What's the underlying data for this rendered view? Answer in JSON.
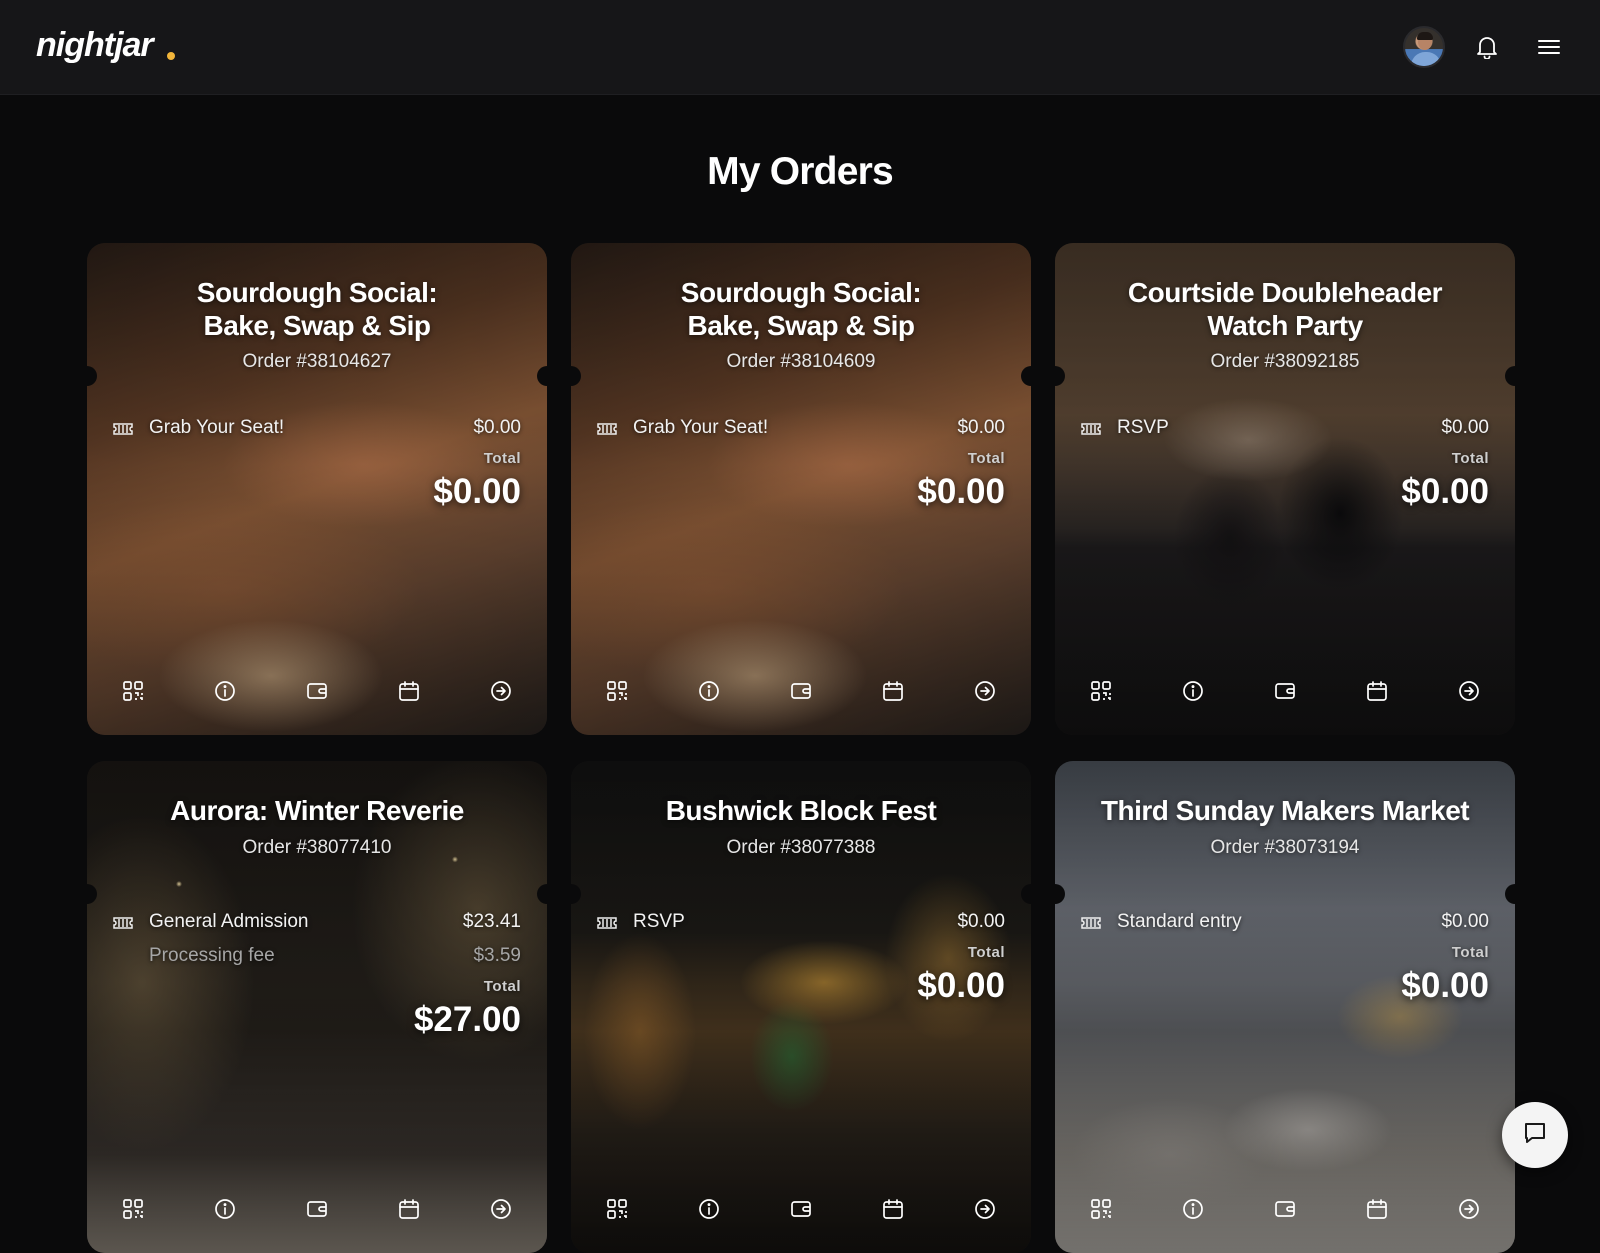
{
  "app": {
    "logo": "nightjar"
  },
  "page": {
    "title": "My Orders"
  },
  "orders": [
    {
      "title_line1": "Sourdough Social:",
      "title_line2": "Bake, Swap & Sip",
      "order": "Order #38104627",
      "ticket": "Grab Your Seat!",
      "ticket_price": "$0.00",
      "total_label": "Total",
      "total": "$0.00",
      "image": "bread-dough-hands"
    },
    {
      "title_line1": "Sourdough Social:",
      "title_line2": "Bake, Swap & Sip",
      "order": "Order #38104609",
      "ticket": "Grab Your Seat!",
      "ticket_price": "$0.00",
      "total_label": "Total",
      "total": "$0.00",
      "image": "bread-dough-hands"
    },
    {
      "title_line1": "Courtside Doubleheader",
      "title_line2": "Watch Party",
      "order": "Order #38092185",
      "ticket": "RSVP",
      "ticket_price": "$0.00",
      "total_label": "Total",
      "total": "$0.00",
      "image": "watch-party-crowd"
    },
    {
      "title_line1": "Aurora: Winter Reverie",
      "title_line2": "",
      "order": "Order #38077410",
      "ticket": "General Admission",
      "ticket_price": "$23.41",
      "fee_label": "Processing fee",
      "fee_price": "$3.59",
      "total_label": "Total",
      "total": "$27.00",
      "image": "winter-lights-street"
    },
    {
      "title_line1": "Bushwick Block Fest",
      "title_line2": "",
      "order": "Order #38077388",
      "ticket": "RSVP",
      "ticket_price": "$0.00",
      "total_label": "Total",
      "total": "$0.00",
      "image": "street-festival-night"
    },
    {
      "title_line1": "Third Sunday Makers Market",
      "title_line2": "",
      "order": "Order #38073194",
      "ticket": "Standard entry",
      "ticket_price": "$0.00",
      "total_label": "Total",
      "total": "$0.00",
      "image": "makers-market-stalls"
    }
  ],
  "icons": {
    "ticket": "ticket-icon",
    "qr": "qr-code-icon",
    "info": "info-icon",
    "wallet": "wallet-icon",
    "calendar": "calendar-icon",
    "arrow": "arrow-right-circle-icon",
    "bell": "bell-icon",
    "menu": "hamburger-menu-icon",
    "chat": "chat-bubble-icon"
  },
  "colors": {
    "background": "#0a0a0b",
    "topbar": "#161618",
    "accent": "#f2b53a"
  }
}
